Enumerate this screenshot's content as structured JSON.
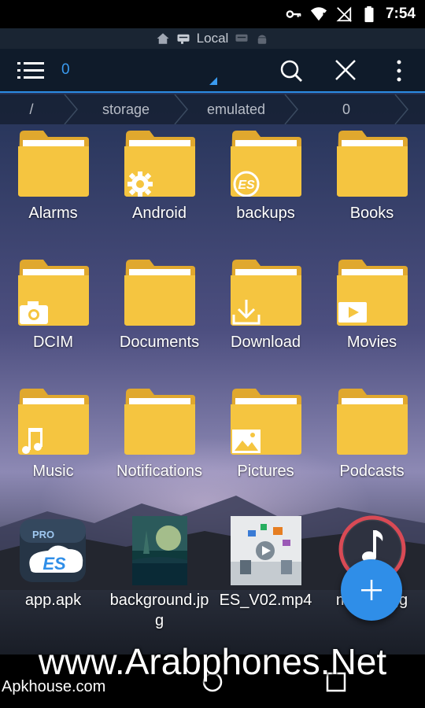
{
  "status_bar": {
    "time": "7:54"
  },
  "location_bar": {
    "label": "Local"
  },
  "toolbar": {
    "path_number": "0"
  },
  "breadcrumb": [
    "/",
    "storage",
    "emulated",
    "0"
  ],
  "items": [
    {
      "name": "Alarms",
      "type": "folder",
      "overlay": ""
    },
    {
      "name": "Android",
      "type": "folder",
      "overlay": "gear-icon"
    },
    {
      "name": "backups",
      "type": "folder",
      "overlay": "es-logo-icon"
    },
    {
      "name": "Books",
      "type": "folder",
      "overlay": ""
    },
    {
      "name": "DCIM",
      "type": "folder",
      "overlay": "camera-icon"
    },
    {
      "name": "Documents",
      "type": "folder",
      "overlay": ""
    },
    {
      "name": "Download",
      "type": "folder",
      "overlay": "download-icon"
    },
    {
      "name": "Movies",
      "type": "folder",
      "overlay": "play-icon"
    },
    {
      "name": "Music",
      "type": "folder",
      "overlay": "music-note-icon"
    },
    {
      "name": "Notifications",
      "type": "folder",
      "overlay": ""
    },
    {
      "name": "Pictures",
      "type": "folder",
      "overlay": "picture-icon"
    },
    {
      "name": "Podcasts",
      "type": "folder",
      "overlay": ""
    },
    {
      "name": "app.apk",
      "type": "apk",
      "overlay": "es-pro-app-icon"
    },
    {
      "name": "background.jpg",
      "type": "image",
      "overlay": ""
    },
    {
      "name": "ES_V02.mp4",
      "type": "video",
      "overlay": ""
    },
    {
      "name": "music.ogg",
      "type": "audio",
      "overlay": "music-note-icon"
    }
  ],
  "colors": {
    "folder": "#f5c540",
    "folder_dark": "#e0a82e",
    "accent": "#2f8ee8",
    "toolbar": "#0f1b2a"
  },
  "watermark": {
    "main": "www.Arabphones.Net",
    "secondary": "Apkhouse.com"
  }
}
